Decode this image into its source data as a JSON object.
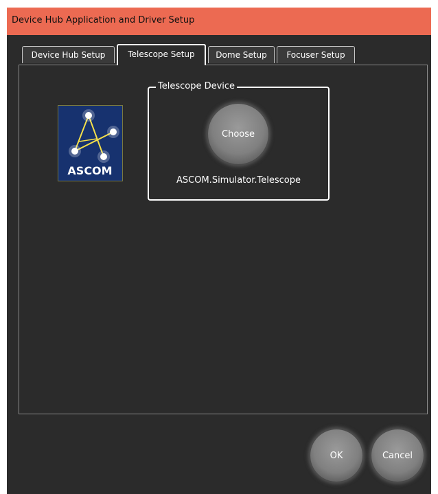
{
  "window": {
    "title": "Device Hub Application and Driver Setup",
    "titlebar_color": "#ec6a52",
    "background_color": "#2b2b2b"
  },
  "tabs": [
    {
      "label": "Device Hub Setup",
      "active": false
    },
    {
      "label": "Telescope Setup",
      "active": true
    },
    {
      "label": "Dome Setup",
      "active": false
    },
    {
      "label": "Focuser Setup",
      "active": false
    }
  ],
  "telescope_panel": {
    "logo": {
      "text": "ASCOM",
      "icon": "ascom-logo-icon"
    },
    "group_label": "Telescope Device",
    "choose_label": "Choose",
    "device_id": "ASCOM.Simulator.Telescope"
  },
  "footer": {
    "ok_label": "OK",
    "cancel_label": "Cancel"
  }
}
